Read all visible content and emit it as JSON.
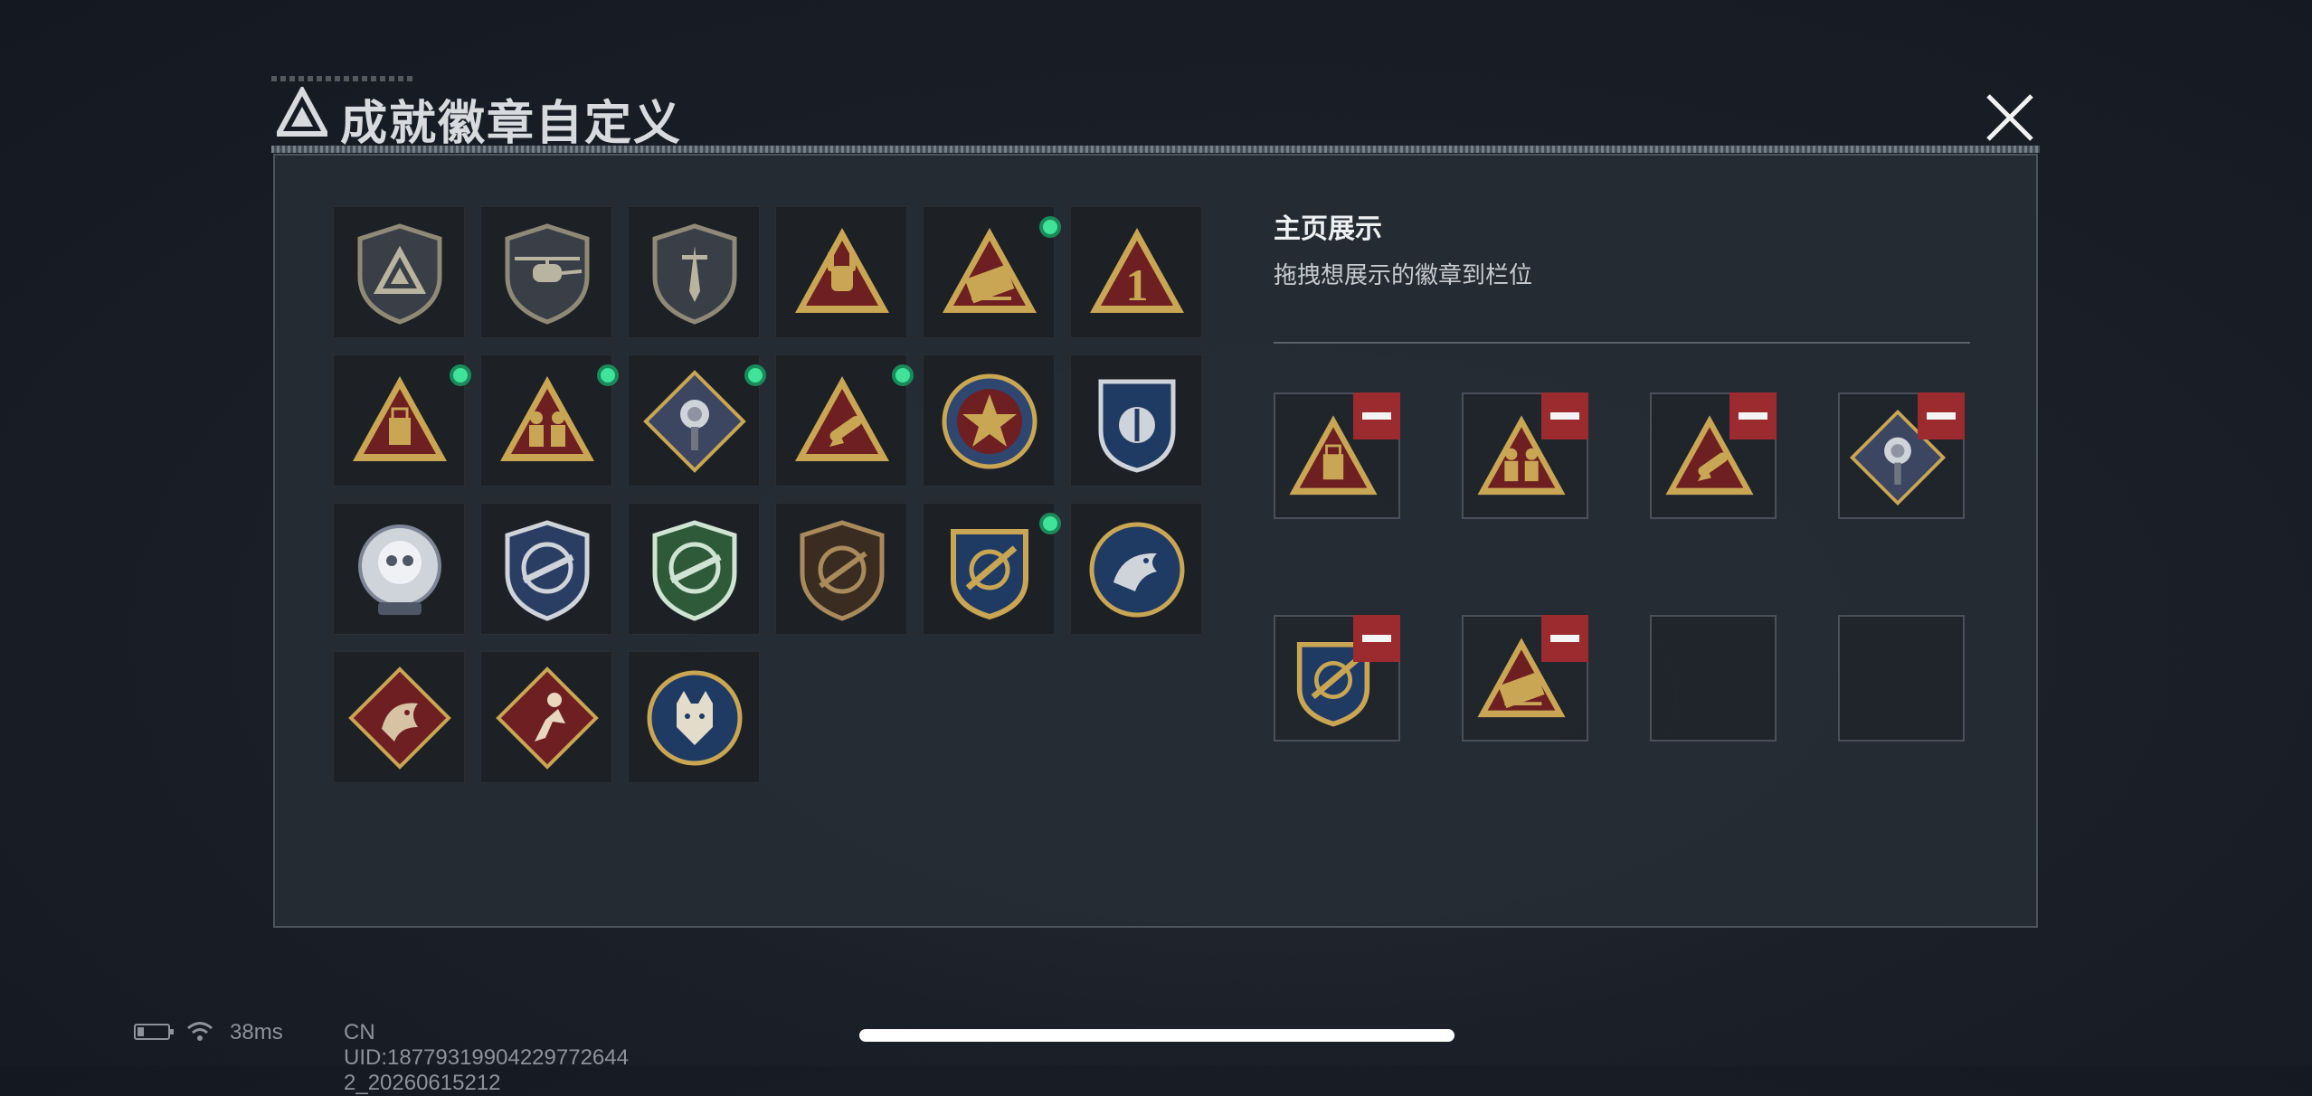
{
  "header": {
    "title": "成就徽章自定义",
    "logo_icon": "triangle-logo-icon",
    "close_icon": "close-icon"
  },
  "badges": [
    {
      "icon": "triangle-shield-badge-icon",
      "new": false
    },
    {
      "icon": "helicopter-shield-badge-icon",
      "new": false
    },
    {
      "icon": "dagger-shield-badge-icon",
      "new": false
    },
    {
      "icon": "rock-hand-triangle-badge-icon",
      "new": false
    },
    {
      "icon": "missile-triangle-badge-icon",
      "new": true
    },
    {
      "icon": "number-one-triangle-badge-icon",
      "new": false
    },
    {
      "icon": "usb-triangle-badge-icon",
      "new": true
    },
    {
      "icon": "soldiers-triangle-badge-icon",
      "new": true
    },
    {
      "icon": "rose-diamond-badge-icon",
      "new": true
    },
    {
      "icon": "rocket-triangle-badge-icon",
      "new": true
    },
    {
      "icon": "star-emblem-badge-icon",
      "new": false
    },
    {
      "icon": "blue-shield-emblem-badge-icon",
      "new": false
    },
    {
      "icon": "white-skull-emblem-badge-icon",
      "new": false
    },
    {
      "icon": "sniper-blue-shield-badge-icon",
      "new": false
    },
    {
      "icon": "sniper-green-shield-badge-icon",
      "new": false
    },
    {
      "icon": "rifle-bronze-shield-badge-icon",
      "new": false
    },
    {
      "icon": "gold-missile-emblem-badge-icon",
      "new": true
    },
    {
      "icon": "eagle-emblem-badge-icon",
      "new": false
    },
    {
      "icon": "dragon-diamond-badge-icon",
      "new": false
    },
    {
      "icon": "runner-diamond-badge-icon",
      "new": false
    },
    {
      "icon": "wolf-emblem-badge-icon",
      "new": false
    }
  ],
  "showcase": {
    "title": "主页展示",
    "subtitle": "拖拽想展示的徽章到栏位",
    "slots": [
      {
        "icon": "usb-triangle-badge-icon",
        "filled": true
      },
      {
        "icon": "soldiers-triangle-badge-icon",
        "filled": true
      },
      {
        "icon": "rocket-triangle-badge-icon",
        "filled": true
      },
      {
        "icon": "rose-diamond-badge-icon",
        "filled": true
      },
      {
        "icon": "gold-missile-emblem-badge-icon",
        "filled": true
      },
      {
        "icon": "missile-triangle-badge-icon",
        "filled": true
      },
      {
        "icon": "",
        "filled": false
      },
      {
        "icon": "",
        "filled": false
      }
    ]
  },
  "status": {
    "ping": "38ms",
    "uid": "CN UID:18779319904229772644​2_20260615212"
  },
  "colors": {
    "accent_new": "#3fe39a",
    "remove": "#9b2b2f",
    "gold": "#c9a654",
    "maroon": "#6e1f22"
  }
}
